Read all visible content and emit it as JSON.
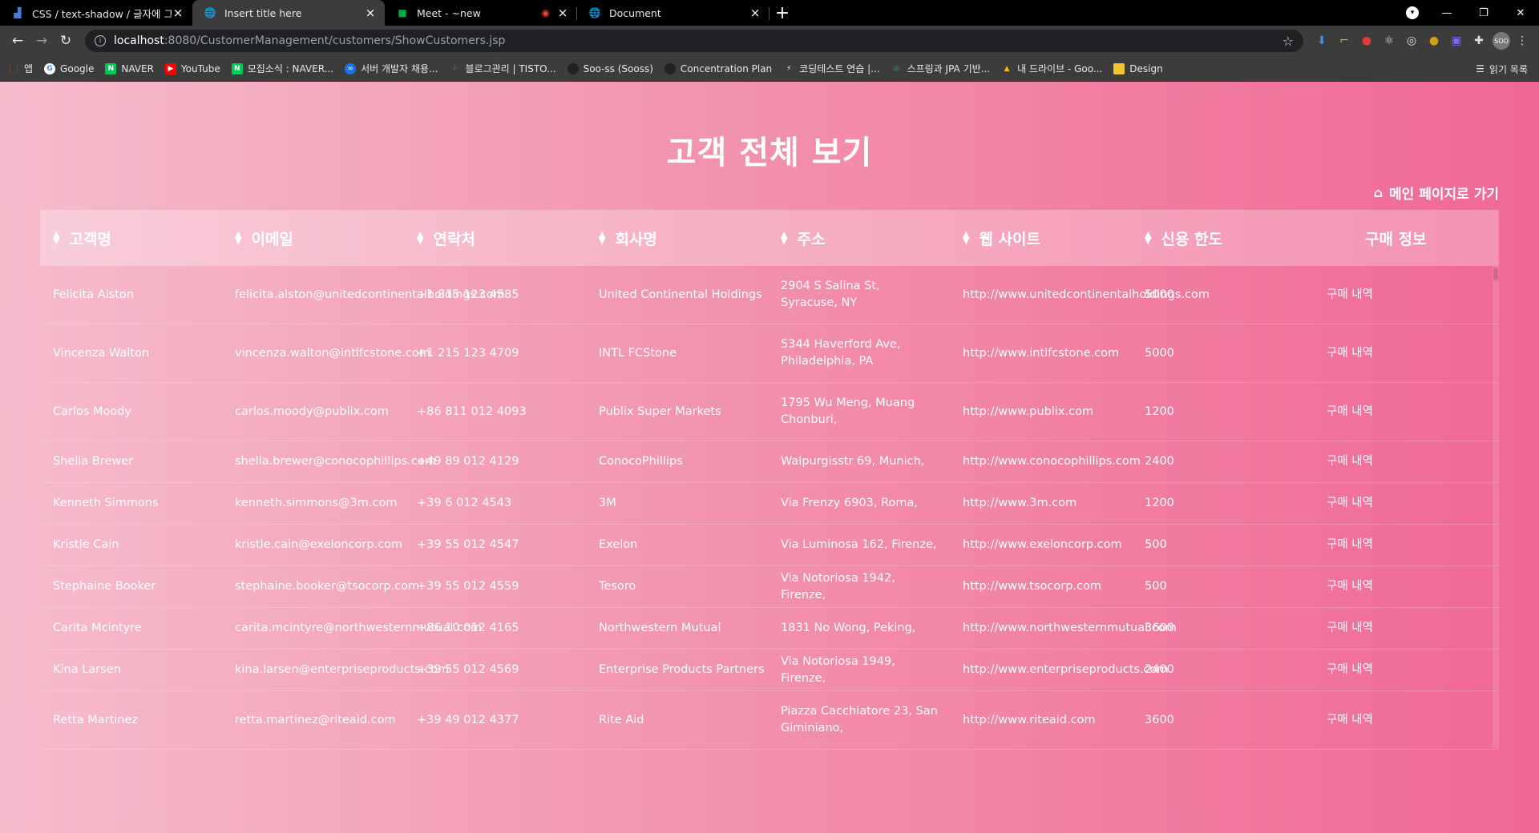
{
  "browser": {
    "tabs": [
      {
        "title": "CSS / text-shadow / 글자에 그림",
        "active": false
      },
      {
        "title": "Insert title here",
        "active": true
      },
      {
        "title": "Meet - ~new",
        "active": false,
        "recording": true
      },
      {
        "title": "Document",
        "active": false
      }
    ],
    "url_host": "localhost",
    "url_path": ":8080/CustomerManagement/customers/ShowCustomers.jsp",
    "bookmarks": [
      {
        "label": "앱",
        "color": "#ea4335"
      },
      {
        "label": "Google",
        "color": "#ffffff"
      },
      {
        "label": "NAVER",
        "color": "#03c75a"
      },
      {
        "label": "YouTube",
        "color": "#ff0000"
      },
      {
        "label": "모집소식 : NAVER...",
        "color": "#03c75a"
      },
      {
        "label": "서버 개발자 채용...",
        "color": "#1a73e8"
      },
      {
        "label": "블로그관리 | TISTO...",
        "color": "#333333"
      },
      {
        "label": "Soo-ss (Sooss)",
        "color": "#222222"
      },
      {
        "label": "Concentration Plan",
        "color": "#222222"
      },
      {
        "label": "코딩테스트 연습 |...",
        "color": "#2b7bd3"
      },
      {
        "label": "스프링과 JPA 기반...",
        "color": "#1faa59"
      },
      {
        "label": "내 드라이브 - Goo...",
        "color": "#fbbc04"
      },
      {
        "label": "Design",
        "color": "#f4c430"
      }
    ],
    "reading_list": "읽기 목록",
    "avatar": "SOO"
  },
  "page": {
    "title": "고객 전체 보기",
    "home_link": "메인 페이지로 가기"
  },
  "table": {
    "headers": [
      "고객명",
      "이메일",
      "연락처",
      "회사명",
      "주소",
      "웹 사이트",
      "신용 한도",
      "구매 정보"
    ],
    "rows": [
      {
        "name": "Felicita Alston",
        "email": "felicita.alston@unitedcontinentalholdings.com",
        "phone": "+1 815 123 4585",
        "company": "United Continental Holdings",
        "address": "2904 S Salina St, Syracuse, NY",
        "website": "http://www.unitedcontinentalholdings.com",
        "credit": "5000",
        "purchase": "구매 내역",
        "height": 73
      },
      {
        "name": "Vincenza Walton",
        "email": "vincenza.walton@intlfcstone.com",
        "phone": "+1 215 123 4709",
        "company": "INTL FCStone",
        "address": "5344 Haverford Ave, Philadelphia, PA",
        "website": "http://www.intlfcstone.com",
        "credit": "5000",
        "purchase": "구매 내역",
        "height": 73
      },
      {
        "name": "Carlos Moody",
        "email": "carlos.moody@publix.com",
        "phone": "+86 811 012 4093",
        "company": "Publix Super Markets",
        "address": "1795 Wu Meng, Muang Chonburi,",
        "website": "http://www.publix.com",
        "credit": "1200",
        "purchase": "구매 내역",
        "height": 73
      },
      {
        "name": "Shelia Brewer",
        "email": "shelia.brewer@conocophillips.com",
        "phone": "+49 89 012 4129",
        "company": "ConocoPhillips",
        "address": "Walpurgisstr 69, Munich,",
        "website": "http://www.conocophillips.com",
        "credit": "2400",
        "purchase": "구매 내역",
        "height": 52
      },
      {
        "name": "Kenneth Simmons",
        "email": "kenneth.simmons@3m.com",
        "phone": "+39 6 012 4543",
        "company": "3M",
        "address": "Via Frenzy 6903, Roma,",
        "website": "http://www.3m.com",
        "credit": "1200",
        "purchase": "구매 내역",
        "height": 52
      },
      {
        "name": "Kristle Cain",
        "email": "kristle.cain@exeloncorp.com",
        "phone": "+39 55 012 4547",
        "company": "Exelon",
        "address": "Via Luminosa 162, Firenze,",
        "website": "http://www.exeloncorp.com",
        "credit": "500",
        "purchase": "구매 내역",
        "height": 52
      },
      {
        "name": "Stephaine Booker",
        "email": "stephaine.booker@tsocorp.com",
        "phone": "+39 55 012 4559",
        "company": "Tesoro",
        "address": "Via Notoriosa 1942, Firenze,",
        "website": "http://www.tsocorp.com",
        "credit": "500",
        "purchase": "구매 내역",
        "height": 52
      },
      {
        "name": "Carita Mcintyre",
        "email": "carita.mcintyre@northwesternmutual.com",
        "phone": "+86 10 012 4165",
        "company": "Northwestern Mutual",
        "address": "1831 No Wong, Peking,",
        "website": "http://www.northwesternmutual.com",
        "credit": "3600",
        "purchase": "구매 내역",
        "height": 52
      },
      {
        "name": "Kina Larsen",
        "email": "kina.larsen@enterpriseproducts.com",
        "phone": "+39 55 012 4569",
        "company": "Enterprise Products Partners",
        "address": "Via Notoriosa 1949, Firenze,",
        "website": "http://www.enterpriseproducts.com",
        "credit": "2400",
        "purchase": "구매 내역",
        "height": 52
      },
      {
        "name": "Retta Martinez",
        "email": "retta.martinez@riteaid.com",
        "phone": "+39 49 012 4377",
        "company": "Rite Aid",
        "address": "Piazza Cacchiatore 23, San Giminiano,",
        "website": "http://www.riteaid.com",
        "credit": "3600",
        "purchase": "구매 내역",
        "height": 73
      }
    ]
  }
}
